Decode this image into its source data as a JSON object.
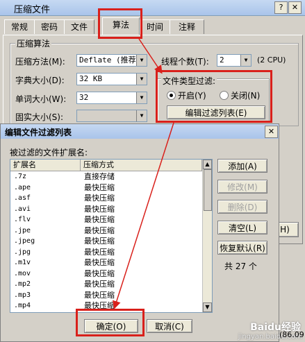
{
  "main_window": {
    "title": "压缩文件",
    "help_btn": "?",
    "close_btn": "✕",
    "tabs": [
      "常规",
      "密码",
      "文件",
      "算法",
      "时间",
      "注释"
    ],
    "group_title": "压缩算法",
    "method_label": "压缩方法(M):",
    "method_value": "Deflate (推荐)",
    "dict_label": "字典大小(D):",
    "dict_value": "32 KB",
    "word_label": "单词大小(W):",
    "word_value": "32",
    "solid_label": "固实大小(S):",
    "solid_value": "",
    "threads_label": "线程个数(T):",
    "threads_value": "2",
    "cpu_note": "(2 CPU)",
    "filter_title": "文件类型过滤:",
    "radio_on": "开启(Y)",
    "radio_off": "关闭(N)",
    "edit_filter_btn": "编辑过滤列表(E)",
    "right_btn_partial": "H)"
  },
  "dialog": {
    "title": "编辑文件过滤列表",
    "close_btn": "✕",
    "list_label": "被过滤的文件扩展名:",
    "columns": [
      "扩展名",
      "压缩方式"
    ],
    "rows": [
      {
        "ext": ".7z",
        "mode": "直接存储"
      },
      {
        "ext": ".ape",
        "mode": "最快压缩"
      },
      {
        "ext": ".asf",
        "mode": "最快压缩"
      },
      {
        "ext": ".avi",
        "mode": "最快压缩"
      },
      {
        "ext": ".flv",
        "mode": "最快压缩"
      },
      {
        "ext": ".jpe",
        "mode": "最快压缩"
      },
      {
        "ext": ".jpeg",
        "mode": "最快压缩"
      },
      {
        "ext": ".jpg",
        "mode": "最快压缩"
      },
      {
        "ext": ".m1v",
        "mode": "最快压缩"
      },
      {
        "ext": ".mov",
        "mode": "最快压缩"
      },
      {
        "ext": ".mp2",
        "mode": "最快压缩"
      },
      {
        "ext": ".mp3",
        "mode": "最快压缩"
      },
      {
        "ext": ".mp4",
        "mode": "最快压缩"
      }
    ],
    "add_btn": "添加(A)",
    "modify_btn": "修改(M)",
    "delete_btn": "删除(D)",
    "clear_btn": "清空(L)",
    "restore_btn": "恢复默认(R)",
    "count_text": "共 27 个",
    "ok_btn": "确定(O)",
    "cancel_btn": "取消(C)"
  },
  "watermark": {
    "brand": "Baidu经验",
    "url": "jingyan.baidu.com",
    "corner_text": "(86.09"
  },
  "annotation_color": "#d9201b"
}
